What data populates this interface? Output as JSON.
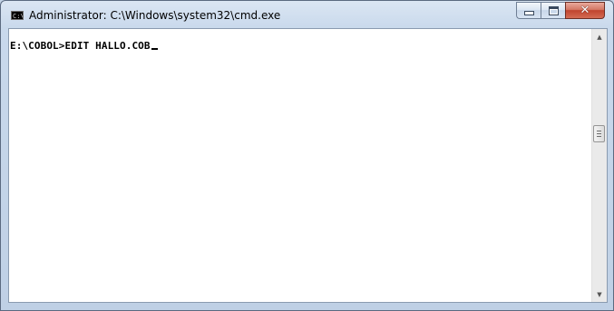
{
  "window": {
    "title": "Administrator: C:\\Windows\\system32\\cmd.exe",
    "icon_label": "C:\\",
    "icon": "console-icon"
  },
  "caption_buttons": {
    "minimize_icon": "minimize-icon",
    "maximize_icon": "maximize-icon",
    "close_icon": "close-icon",
    "close_glyph": "✕"
  },
  "console": {
    "prompt": "E:\\COBOL>",
    "command": "EDIT HALLO.COB"
  },
  "scrollbar": {
    "up_arrow": "▲",
    "down_arrow": "▼"
  }
}
